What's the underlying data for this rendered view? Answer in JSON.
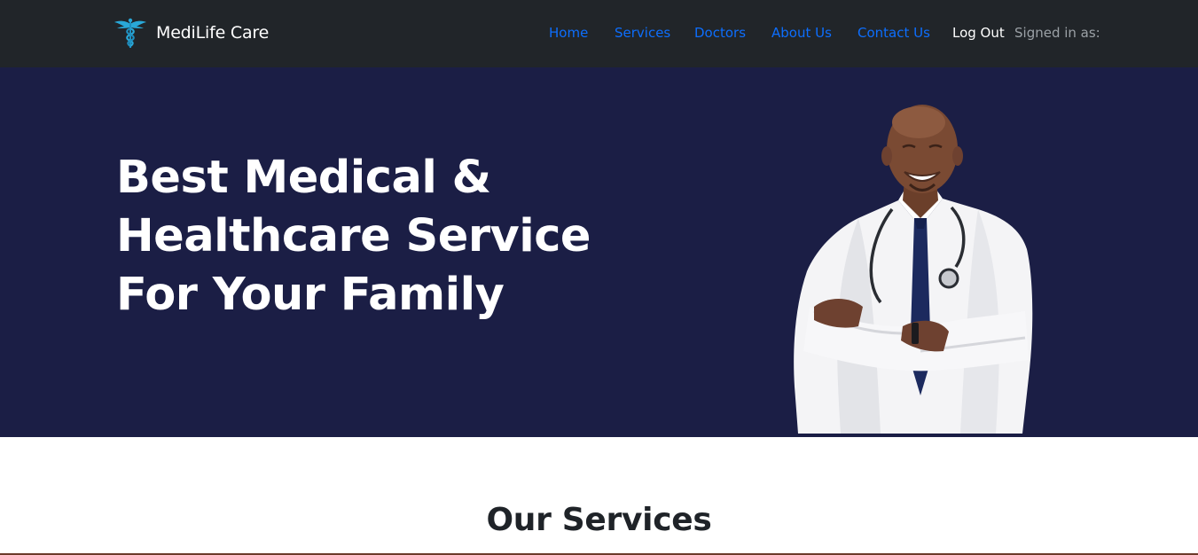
{
  "navbar": {
    "brand_name": "MediLife Care",
    "brand_icon": "caduceus-icon",
    "links": [
      {
        "label": "Home"
      },
      {
        "label": "Services"
      },
      {
        "label": "Doctors"
      },
      {
        "label": "About Us"
      },
      {
        "label": "Contact Us"
      }
    ],
    "logout_label": "Log Out",
    "signed_in_label": "Signed in as:"
  },
  "hero": {
    "title_lines": [
      "Best Medical &",
      "Healthcare Service",
      "For Your Family"
    ],
    "image": "doctor-portrait"
  },
  "services": {
    "title": "Our Services"
  },
  "colors": {
    "navbar_bg": "#212529",
    "hero_bg": "#1b1e45",
    "link": "#0d6efd",
    "logo": "#29a8d8"
  }
}
